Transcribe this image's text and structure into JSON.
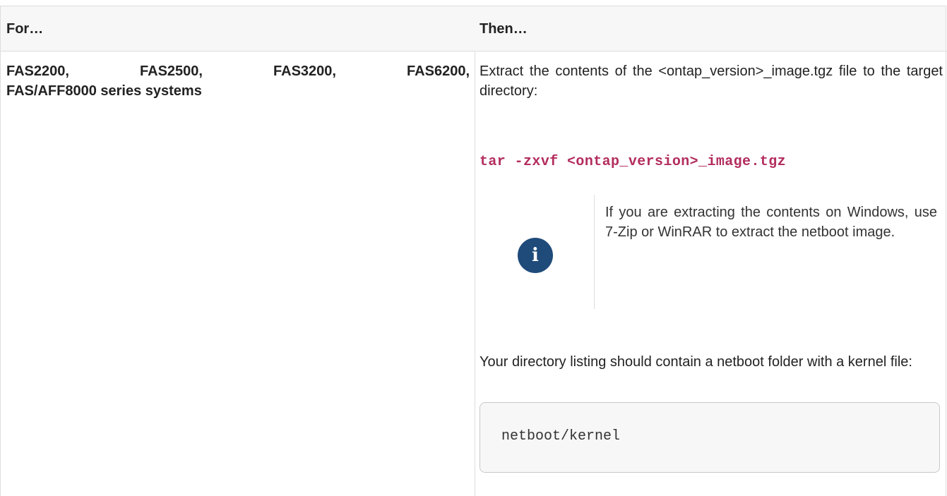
{
  "table": {
    "header": {
      "left": "For…",
      "right": "Then…"
    },
    "row": {
      "systems_line1": "FAS2200, FAS2500, FAS3200, FAS6200,",
      "systems_line2": "FAS/AFF8000 series systems",
      "extract_text": "Extract the contents of the <ontap_version>_image.tgz file to the target directory:",
      "command": "tar -zxvf <ontap_version>_image.tgz",
      "note": {
        "icon": "info-icon",
        "text": "If you are extracting the contents on Windows, use 7-Zip or WinRAR to extract the netboot image."
      },
      "listing_text": "Your directory listing should contain a netboot folder with a kernel file:",
      "listing_code": "netboot/kernel"
    }
  },
  "colors": {
    "command": "#b32d5e",
    "info_icon_bg": "#1f4b7a",
    "border": "#dddddd",
    "header_bg": "#f7f7f7"
  }
}
